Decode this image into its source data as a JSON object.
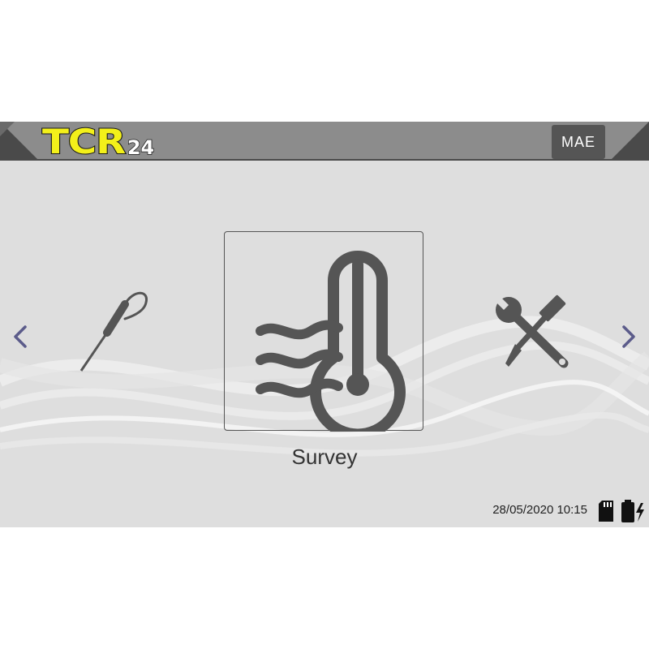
{
  "header": {
    "logo_main": "TCR",
    "logo_sub": "24",
    "brand_badge": "MAE"
  },
  "carousel": {
    "current_item_label": "Survey",
    "current_item_icon": "thermometer-icon",
    "previous_item_icon": "probe-icon",
    "next_item_icon": "tools-icon"
  },
  "status_bar": {
    "datetime": "28/05/2020 10:15",
    "storage_icon": "sd-card-icon",
    "battery_icon": "battery-charging-icon"
  },
  "colors": {
    "screen_background": "#dedede",
    "header_gray": "#8c8c8c",
    "header_dark": "#4a4a4a",
    "logo_yellow": "#f3f01a",
    "icon_gray": "#555555",
    "nav_arrow": "#5b5b8a"
  }
}
